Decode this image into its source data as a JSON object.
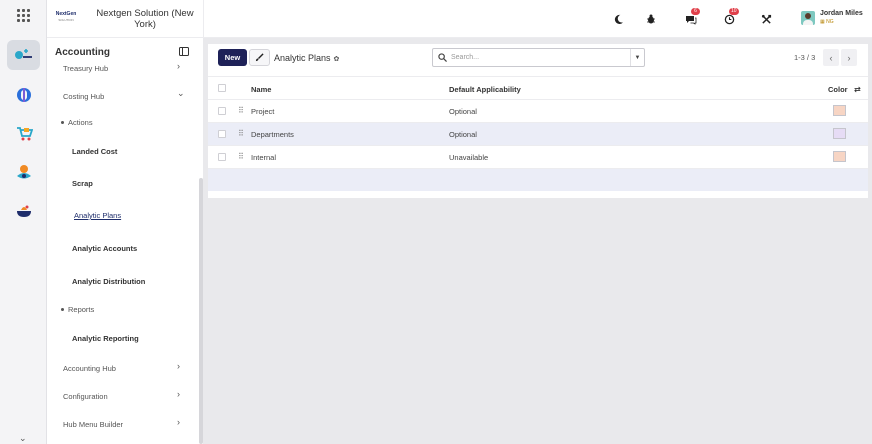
{
  "header": {
    "logo_text": "NextGen",
    "logo_sub": "SOLUTION",
    "company": "Nextgen Solution (New York)",
    "icons": [
      "moon-icon",
      "bug-icon",
      "chat-icon",
      "clock-icon",
      "tools-icon"
    ],
    "chat_badge": "6",
    "activity_badge": "10",
    "user_name": "Jordan Miles",
    "user_org": "NG"
  },
  "rail": {
    "apps": [
      "accounting-app-icon",
      "discuss-app-icon",
      "sales-app-icon",
      "contacts-app-icon",
      "cooking-app-icon"
    ]
  },
  "sidebar": {
    "title": "Accounting",
    "items": [
      {
        "label": "Treasury Hub",
        "type": "hub",
        "arrow": "›"
      },
      {
        "label": "Costing Hub",
        "type": "hub",
        "arrow": "⌄"
      },
      {
        "label": "Actions",
        "type": "section"
      },
      {
        "label": "Landed Cost",
        "type": "link"
      },
      {
        "label": "Scrap",
        "type": "link"
      },
      {
        "label": "Analytic Plans",
        "type": "active"
      },
      {
        "label": "Analytic Accounts",
        "type": "link"
      },
      {
        "label": "Analytic Distribution",
        "type": "link"
      },
      {
        "label": "Reports",
        "type": "section"
      },
      {
        "label": "Analytic Reporting",
        "type": "link"
      },
      {
        "label": "Accounting Hub",
        "type": "hub",
        "arrow": "›"
      },
      {
        "label": "Configuration",
        "type": "hub",
        "arrow": "›"
      },
      {
        "label": "Hub Menu Builder",
        "type": "hub",
        "arrow": "›"
      }
    ]
  },
  "toolbar": {
    "new_label": "New",
    "breadcrumb": "Analytic Plans",
    "search_placeholder": "Search...",
    "pager": "1-3 / 3"
  },
  "table": {
    "columns": [
      "Name",
      "Default Applicability",
      "Color"
    ],
    "rows": [
      {
        "name": "Project",
        "applicability": "Optional",
        "color": "#f7d5c4"
      },
      {
        "name": "Departments",
        "applicability": "Optional",
        "color": "#e6dcf5"
      },
      {
        "name": "Internal",
        "applicability": "Unavailable",
        "color": "#f7d5c4"
      }
    ]
  }
}
